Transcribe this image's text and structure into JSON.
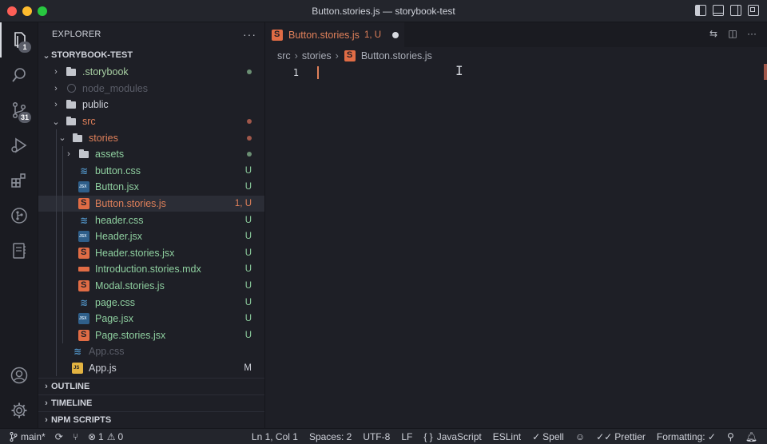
{
  "window": {
    "title": "Button.stories.js — storybook-test"
  },
  "activity": {
    "items": [
      {
        "name": "explorer-icon",
        "badge": "1"
      },
      {
        "name": "search-icon",
        "badge": ""
      },
      {
        "name": "source-control-icon",
        "badge": "31"
      },
      {
        "name": "run-debug-icon",
        "badge": ""
      },
      {
        "name": "extensions-icon",
        "badge": ""
      },
      {
        "name": "git-graph-icon",
        "badge": ""
      },
      {
        "name": "notebook-icon",
        "badge": ""
      }
    ],
    "bottom": [
      {
        "name": "account-icon"
      },
      {
        "name": "settings-gear-icon"
      }
    ]
  },
  "sidebar": {
    "title": "EXPLORER",
    "more": "···",
    "root": "STORYBOOK-TEST",
    "tree": [
      {
        "label": ".storybook",
        "indent": 0,
        "type": "folder",
        "chev": "›",
        "status": "",
        "dot": "g",
        "color": "storybook"
      },
      {
        "label": "node_modules",
        "indent": 0,
        "type": "node",
        "chev": "›",
        "status": "",
        "dot": "",
        "color": "dim"
      },
      {
        "label": "public",
        "indent": 0,
        "type": "folder",
        "chev": "›",
        "status": "",
        "dot": "",
        "color": "white"
      },
      {
        "label": "src",
        "indent": 0,
        "type": "folder",
        "chev": "⌄",
        "status": "",
        "dot": "r",
        "color": "orange"
      },
      {
        "label": "stories",
        "indent": 1,
        "type": "folder",
        "chev": "⌄",
        "status": "",
        "dot": "r",
        "color": "orange"
      },
      {
        "label": "assets",
        "indent": 2,
        "type": "folder",
        "chev": "›",
        "status": "",
        "dot": "g",
        "color": "green"
      },
      {
        "label": "button.css",
        "indent": 2,
        "type": "css",
        "chev": "",
        "status": "U",
        "dot": "",
        "color": "green"
      },
      {
        "label": "Button.jsx",
        "indent": 2,
        "type": "jsx",
        "chev": "",
        "status": "U",
        "dot": "",
        "color": "green"
      },
      {
        "label": "Button.stories.js",
        "indent": 2,
        "type": "story",
        "chev": "",
        "status": "1, U",
        "dot": "",
        "color": "orange",
        "selected": true
      },
      {
        "label": "header.css",
        "indent": 2,
        "type": "css",
        "chev": "",
        "status": "U",
        "dot": "",
        "color": "green"
      },
      {
        "label": "Header.jsx",
        "indent": 2,
        "type": "jsx",
        "chev": "",
        "status": "U",
        "dot": "",
        "color": "green"
      },
      {
        "label": "Header.stories.jsx",
        "indent": 2,
        "type": "story",
        "chev": "",
        "status": "U",
        "dot": "",
        "color": "green"
      },
      {
        "label": "Introduction.stories.mdx",
        "indent": 2,
        "type": "mdx",
        "chev": "",
        "status": "U",
        "dot": "",
        "color": "green"
      },
      {
        "label": "Modal.stories.js",
        "indent": 2,
        "type": "story",
        "chev": "",
        "status": "U",
        "dot": "",
        "color": "green"
      },
      {
        "label": "page.css",
        "indent": 2,
        "type": "css",
        "chev": "",
        "status": "U",
        "dot": "",
        "color": "green"
      },
      {
        "label": "Page.jsx",
        "indent": 2,
        "type": "jsx",
        "chev": "",
        "status": "U",
        "dot": "",
        "color": "green"
      },
      {
        "label": "Page.stories.jsx",
        "indent": 2,
        "type": "story",
        "chev": "",
        "status": "U",
        "dot": "",
        "color": "green"
      },
      {
        "label": "App.css",
        "indent": 1,
        "type": "css",
        "chev": "",
        "status": "",
        "dot": "",
        "color": "dim"
      },
      {
        "label": "App.js",
        "indent": 1,
        "type": "js",
        "chev": "",
        "status": "M",
        "dot": "",
        "color": "white"
      }
    ],
    "sections": [
      "OUTLINE",
      "TIMELINE",
      "NPM SCRIPTS"
    ]
  },
  "editor": {
    "tab": {
      "name": "Button.stories.js",
      "status": "1, U"
    },
    "breadcrumb": [
      "src",
      "stories",
      "Button.stories.js"
    ],
    "lines": [
      "1"
    ]
  },
  "statusbar": {
    "branch": "main*",
    "problems_errors": "1",
    "problems_warnings": "0",
    "position": "Ln 1, Col 1",
    "spaces": "Spaces: 2",
    "encoding": "UTF-8",
    "eol": "LF",
    "language": "JavaScript",
    "eslint": "ESLint",
    "spell": "Spell",
    "prettier": "Prettier",
    "formatting": "Formatting: ✓"
  },
  "colors": {
    "accent": "#e0805a",
    "untracked": "#8fd0a0",
    "background": "#1e1f26"
  }
}
